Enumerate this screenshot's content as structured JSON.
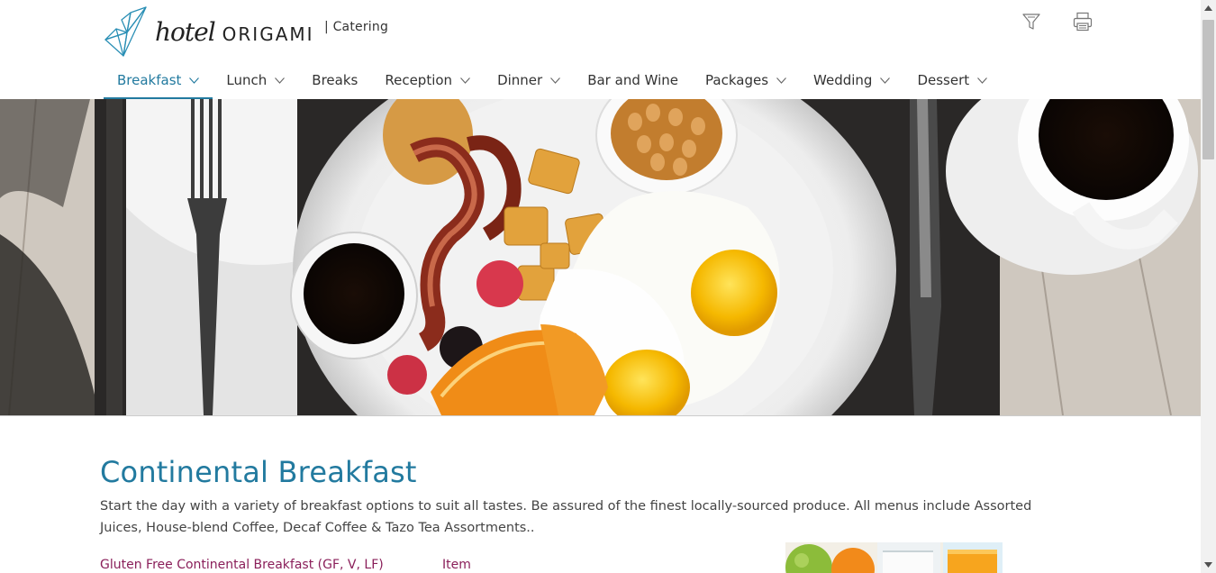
{
  "header": {
    "logo_hotel": "hotel",
    "logo_origami": "ORIGAMI",
    "subtitle": "| Catering",
    "icons": [
      "filter-icon",
      "printer-icon"
    ]
  },
  "nav": {
    "items": [
      {
        "label": "Breakfast",
        "has_dropdown": true,
        "active": true
      },
      {
        "label": "Lunch",
        "has_dropdown": true
      },
      {
        "label": "Breaks",
        "has_dropdown": false
      },
      {
        "label": "Reception",
        "has_dropdown": true
      },
      {
        "label": "Dinner",
        "has_dropdown": true
      },
      {
        "label": "Bar and Wine",
        "has_dropdown": false
      },
      {
        "label": "Packages",
        "has_dropdown": true
      },
      {
        "label": "Wedding",
        "has_dropdown": true
      },
      {
        "label": "Dessert",
        "has_dropdown": true
      }
    ]
  },
  "main": {
    "title": "Continental Breakfast",
    "intro": "Start the day with a variety of breakfast options to suit all tastes. Be assured of the finest locally-sourced produce. All menus include Assorted Juices, House-blend Coffee, Decaf Coffee & Tazo Tea Assortments..",
    "menu_item_title": "Gluten Free Continental Breakfast (GF, V, LF)",
    "column_header": "Item"
  },
  "colors": {
    "accent": "#227a9f",
    "menu_item": "#8a1f5a",
    "text": "#444444"
  }
}
